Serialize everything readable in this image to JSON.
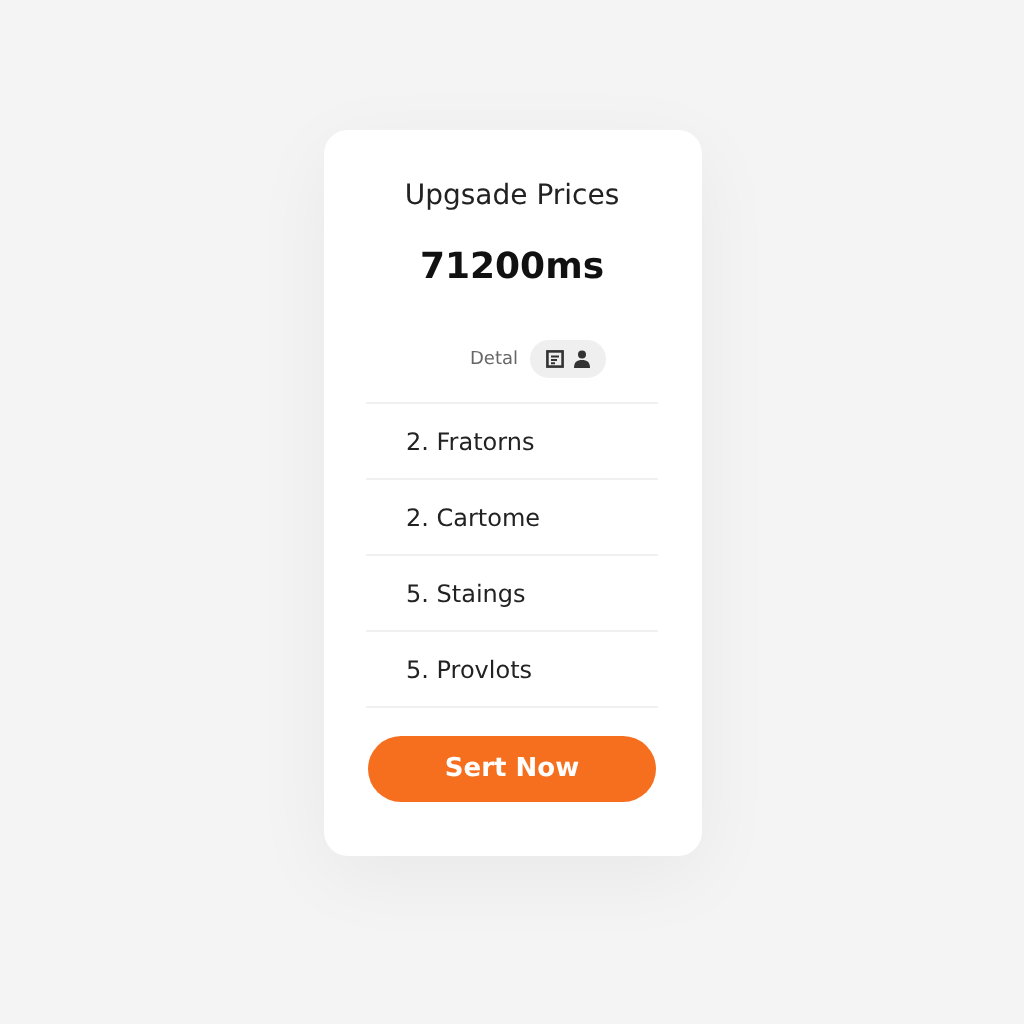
{
  "card": {
    "title": "Upgsade Prices",
    "value": "71200ms",
    "detail_label": "Detal",
    "items": [
      {
        "text": "2. Fratorns"
      },
      {
        "text": "2. Cartome"
      },
      {
        "text": "5. Staings"
      },
      {
        "text": "5. Provlots"
      }
    ],
    "button": "Sert Now"
  }
}
